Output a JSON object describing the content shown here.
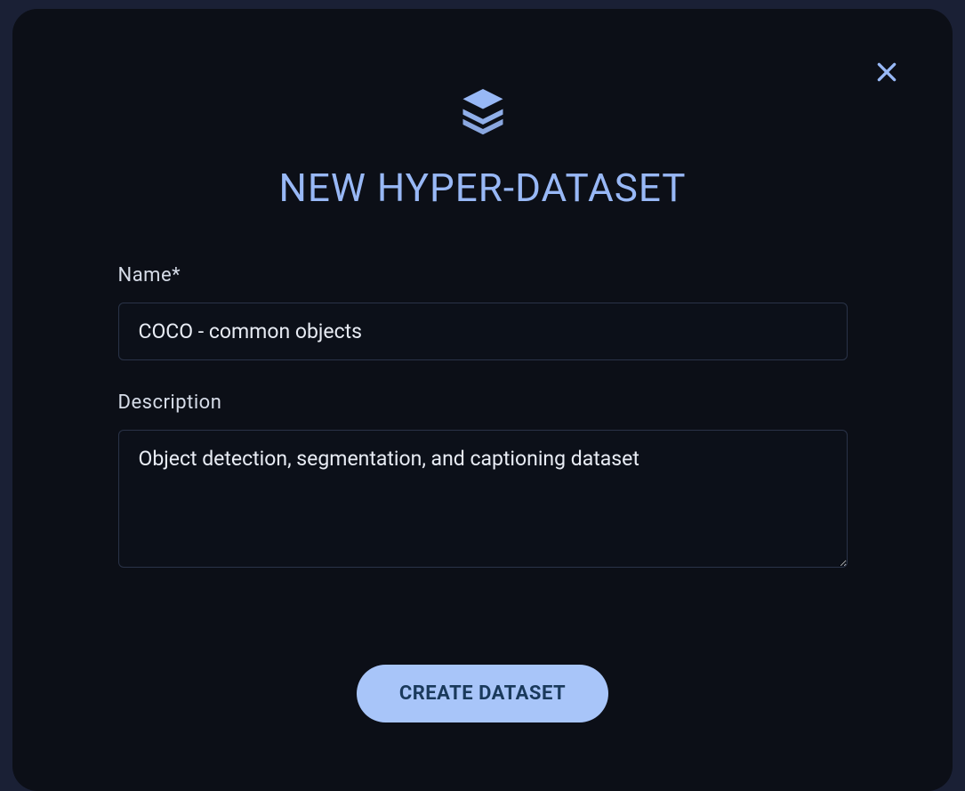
{
  "modal": {
    "title": "NEW HYPER-DATASET",
    "name_label": "Name*",
    "name_value": "COCO - common objects",
    "description_label": "Description",
    "description_value": "Object detection, segmentation, and captioning dataset",
    "create_button_label": "CREATE DATASET"
  }
}
